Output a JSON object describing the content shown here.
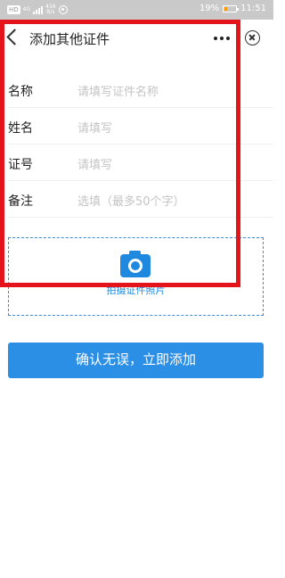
{
  "status_bar": {
    "hd_badge": "HD",
    "network": "4G",
    "speed_value": "416",
    "speed_unit": "B/s",
    "battery_percent_text": "19%",
    "battery_level": 0.19,
    "battery_color": "#ff9a00",
    "time": "11:51"
  },
  "nav": {
    "title": "添加其他证件",
    "back_icon": "chevron-left-icon",
    "more_icon": "more-horizontal-icon",
    "close_icon": "close-circle-icon"
  },
  "form": {
    "fields": [
      {
        "label": "名称",
        "placeholder": "请填写证件名称"
      },
      {
        "label": "姓名",
        "placeholder": "请填写"
      },
      {
        "label": "证号",
        "placeholder": "请填写"
      },
      {
        "label": "备注",
        "placeholder": "选填（最多50个字）"
      }
    ]
  },
  "photo": {
    "label": "拍摄证件照片",
    "icon": "camera-icon",
    "accent": "#1f89e0"
  },
  "confirm_button": {
    "label": "确认无误，立即添加",
    "color": "#2c8fe6"
  },
  "highlight_color": "#e5141a"
}
